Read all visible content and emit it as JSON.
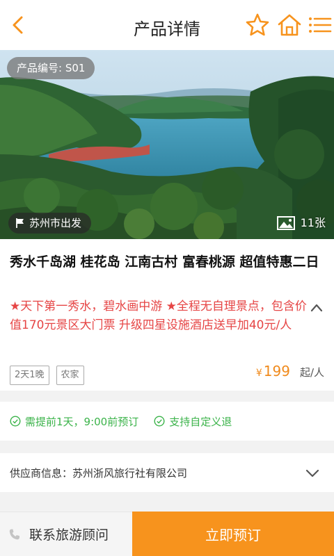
{
  "header": {
    "title": "产品详情",
    "back_icon": "chevron-left-icon",
    "favorite_icon": "star-icon",
    "home_icon": "home-icon",
    "menu_icon": "menu-icon",
    "accent_color": "#f7931d"
  },
  "hero": {
    "product_code": "产品编号: S01",
    "departure": "苏州市出发",
    "photo_count": "11张"
  },
  "product": {
    "name": "秀水千岛湖 桂花岛 江南古村 富春桃源 超值特惠二日",
    "description": "★天下第一秀水，碧水画中游 ★全程无自理景点，包含价值170元景区大门票 升级四星设施酒店送早加40元/人",
    "tags": [
      "2天1晚",
      "农家"
    ],
    "price_currency": "¥",
    "price_value": "199",
    "price_unit": "起/人",
    "highlight_color": "#e64545"
  },
  "conditions": {
    "advance": "需提前1天，9:00前预订",
    "refund": "支持自定义退",
    "color": "#3bb34a"
  },
  "supplier": {
    "label": "供应商信息：苏州浙风旅行社有限公司"
  },
  "footer": {
    "consult_label": "联系旅游顾问",
    "book_label": "立即预订"
  }
}
